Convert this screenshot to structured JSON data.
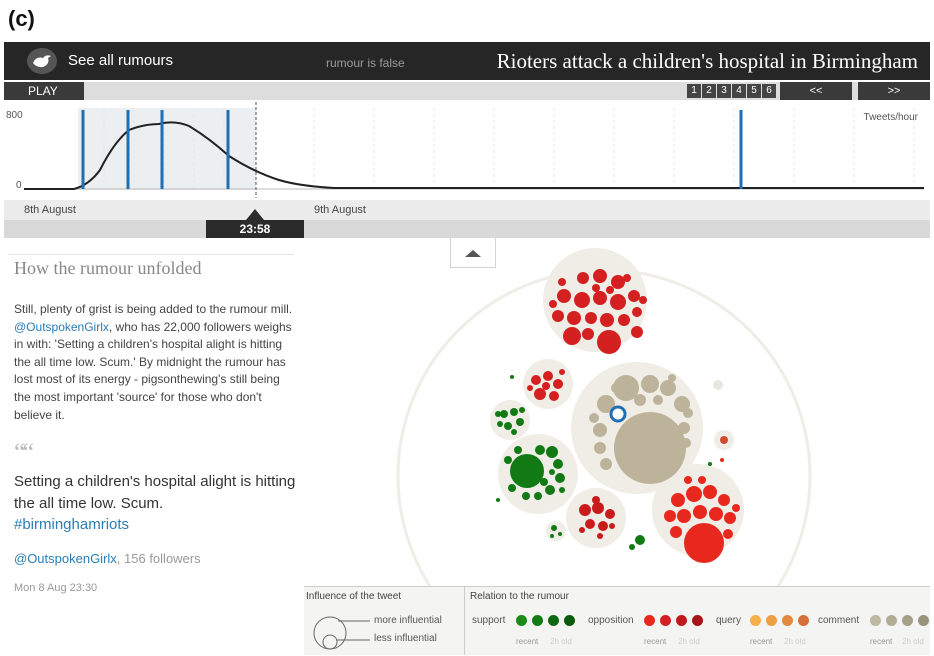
{
  "panel_label": "(c)",
  "header": {
    "see_all": "See all rumours",
    "status": "rumour is false",
    "headline": "Rioters attack a children's hospital in Birmingham"
  },
  "controls": {
    "play": "PLAY",
    "days": [
      "1",
      "2",
      "3",
      "4",
      "5",
      "6"
    ],
    "prev": "<<",
    "next": ">>"
  },
  "timeline": {
    "y_max_label": "800",
    "y_min_label": "0",
    "unit_label": "Tweets/hour",
    "dates": [
      "8th August",
      "9th August"
    ],
    "current_time": "23:58"
  },
  "story": {
    "title": "How the rumour unfolded",
    "body_1": "Still, plenty of grist is being added to the rumour mill. ",
    "body_handle": "@OutspokenGirlx",
    "body_2": ", who has 22,000 followers weighs in with: 'Setting a children's hospital alight is hitting the all time low. Scum.' By midnight the rumour has lost most of its energy - pigsonthewing's still being the most important 'source' for those who don't believe it.",
    "quote_mark": "““",
    "tweet_text": "Setting a children's hospital alight is hitting the all time low. Scum.",
    "tweet_hashtag": "#birminghamriots",
    "tweet_handle": "@OutspokenGirlx",
    "tweet_followers": ", 156 followers",
    "tweet_time": "Mon 8 Aug 23:30"
  },
  "legend": {
    "influence_title": "Influence of the tweet",
    "more": "more influential",
    "less": "less influential",
    "relation_title": "Relation to the rumour",
    "support": "support",
    "opposition": "opposition",
    "query": "query",
    "comment": "comment",
    "recent": "recent",
    "old": "2h old",
    "colors": {
      "support": [
        "#1a8a1a",
        "#147a14",
        "#0e6a10",
        "#0a5a0c"
      ],
      "opposition": [
        "#e8281e",
        "#d42020",
        "#c01a1c",
        "#a81418"
      ],
      "query": [
        "#f5b04a",
        "#eea044",
        "#e28a3e",
        "#d4703a"
      ],
      "comment": [
        "#bfb8a2",
        "#b3ab94",
        "#a69e86",
        "#99917a"
      ]
    }
  }
}
